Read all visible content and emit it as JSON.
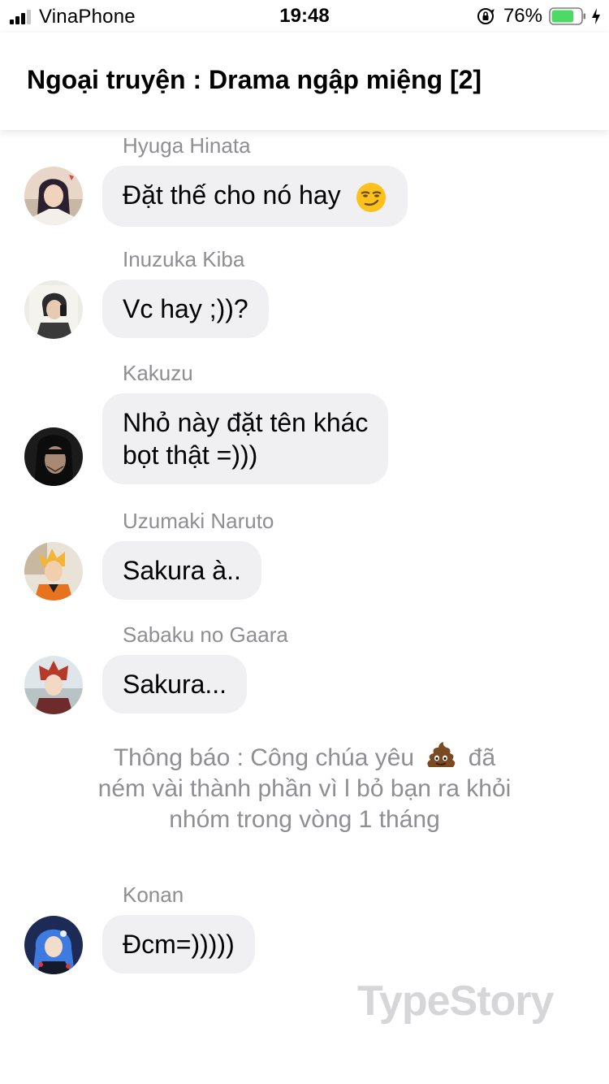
{
  "status_bar": {
    "carrier": "VinaPhone",
    "time": "19:48",
    "battery_percent": "76%",
    "battery_level": 0.76,
    "signal_bars": 3,
    "signal_max": 4
  },
  "header": {
    "title": "Ngoại truyện : Drama ngập miệng [2]"
  },
  "messages": [
    {
      "sender": "Hyuga Hinata",
      "text": "Đặt thế cho nó hay",
      "emoji": "smirk-emoji"
    },
    {
      "sender": "Inuzuka Kiba",
      "text": "Vc hay ;))?"
    },
    {
      "sender": "Kakuzu",
      "line1": "Nhỏ này đặt tên khác",
      "line2": "bọt thật =)))"
    },
    {
      "sender": "Uzumaki Naruto",
      "text": "Sakura à.."
    },
    {
      "sender": "Sabaku no Gaara",
      "text": "Sakura..."
    },
    {
      "sender": "Konan",
      "text": "Đcm=)))))"
    }
  ],
  "notice": {
    "line1_a": "Thông báo : Công chúa yêu",
    "line1_b": "đã",
    "line2": "ném vài thành phần vì l bỏ bạn ra khỏi",
    "line3": "nhóm trong vòng 1 tháng",
    "emoji": "poo-emoji"
  },
  "watermark": "TypeStory",
  "colors": {
    "bubble": "#f0f0f3",
    "name_gray": "#8e8e93",
    "battery_green": "#4cd964"
  }
}
